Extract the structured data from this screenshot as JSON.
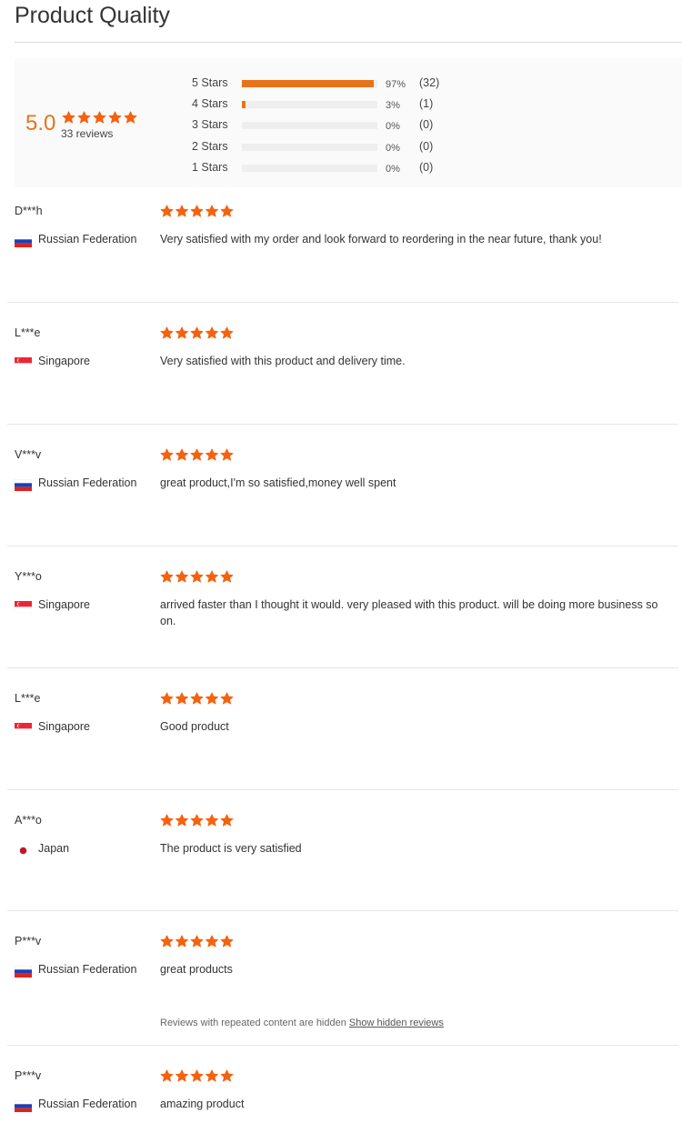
{
  "page_title": "Product Quality",
  "summary": {
    "average": "5.0",
    "average_stars": 5,
    "review_count_text": "33 reviews",
    "distribution": [
      {
        "label": "5 Stars",
        "percent_text": "97%",
        "count_text": "(32)",
        "fraction": 0.97
      },
      {
        "label": "4 Stars",
        "percent_text": "3%",
        "count_text": "(1)",
        "fraction": 0.03
      },
      {
        "label": "3 Stars",
        "percent_text": "0%",
        "count_text": "(0)",
        "fraction": 0
      },
      {
        "label": "2 Stars",
        "percent_text": "0%",
        "count_text": "(0)",
        "fraction": 0
      },
      {
        "label": "1 Stars",
        "percent_text": "0%",
        "count_text": "(0)",
        "fraction": 0
      }
    ]
  },
  "reviews": [
    {
      "name": "D***h",
      "country": "Russian Federation",
      "flag": "flag-russia-icon",
      "stars": 5,
      "text": "Very satisfied with my order and look forward to reordering in the near future, thank you!"
    },
    {
      "name": "L***e",
      "country": "Singapore",
      "flag": "flag-singapore-icon",
      "stars": 5,
      "text": "Very satisfied with this product and delivery time."
    },
    {
      "name": "V***v",
      "country": "Russian Federation",
      "flag": "flag-russia-icon",
      "stars": 5,
      "text": "great product,I'm so satisfied,money well spent"
    },
    {
      "name": "Y***o",
      "country": "Singapore",
      "flag": "flag-singapore-icon",
      "stars": 5,
      "text": "arrived faster than I thought it would. very pleased with this product. will be doing more business so on."
    },
    {
      "name": "L***e",
      "country": "Singapore",
      "flag": "flag-singapore-icon",
      "stars": 5,
      "text": "Good product"
    },
    {
      "name": "A***o",
      "country": "Japan",
      "flag": "flag-japan-icon",
      "stars": 5,
      "text": "The product is very satisfied"
    },
    {
      "name": "P***v",
      "country": "Russian Federation",
      "flag": "flag-russia-icon",
      "stars": 5,
      "text": "great products"
    },
    {
      "name": "P***v",
      "country": "Russian Federation",
      "flag": "flag-russia-icon",
      "stars": 5,
      "text": "amazing product"
    }
  ],
  "hidden_notice": {
    "text": "Reviews with repeated content are hidden",
    "link_label": "Show hidden reviews"
  },
  "colors": {
    "star": "#f5620f",
    "accent": "#e8731a",
    "track": "#eeeeee"
  }
}
